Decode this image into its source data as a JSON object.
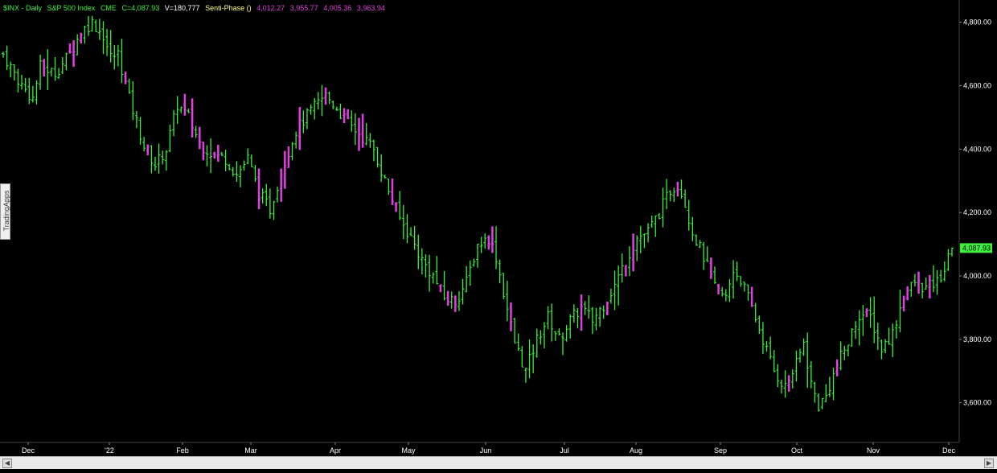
{
  "header": {
    "symbol": "$INX - Daily",
    "name": "S&P 500 Index",
    "exchange": "CME",
    "close": "C=4,087.93",
    "volume": "V=180,777",
    "indicator": "Senti-Phase ()",
    "values": [
      "4,012.27",
      "3,955.77",
      "4,005.36",
      "3,963.94"
    ]
  },
  "watermark": "TradingApps",
  "colors": {
    "background": "#000000",
    "bar_normal": "#3cf03c",
    "bar_phase": "#e040e0",
    "axis_text": "#ffffff",
    "last_price_bg": "#3cf03c"
  },
  "chart_data": {
    "type": "ohlc",
    "title": "$INX - Daily  S&P 500 Index  CME",
    "ylim": [
      3480,
      4850
    ],
    "y_ticks": [
      "4,800.00",
      "4,600.00",
      "4,400.00",
      "4,200.00",
      "4,000.00",
      "3,800.00",
      "3,600.00"
    ],
    "y_tick_values": [
      4800,
      4600,
      4400,
      4200,
      4000,
      3800,
      3600
    ],
    "x_labels": [
      "Dec",
      "'22",
      "Feb",
      "Mar",
      "Apr",
      "May",
      "Jun",
      "Jul",
      "Aug",
      "Sep",
      "Oct",
      "Nov",
      "Dec"
    ],
    "last_price": "4,087.93",
    "last_value": 4087.93,
    "grid": false,
    "series": [
      {
        "anchors": [
          [
            0,
            4700
          ],
          [
            5,
            4600
          ],
          [
            8,
            4560
          ],
          [
            10,
            4660
          ],
          [
            14,
            4640
          ],
          [
            18,
            4700
          ],
          [
            21,
            4770
          ],
          [
            24,
            4800
          ],
          [
            27,
            4760
          ],
          [
            29,
            4690
          ],
          [
            31,
            4700
          ],
          [
            34,
            4560
          ],
          [
            38,
            4410
          ],
          [
            41,
            4350
          ],
          [
            44,
            4400
          ],
          [
            47,
            4540
          ],
          [
            50,
            4500
          ],
          [
            53,
            4420
          ],
          [
            57,
            4380
          ],
          [
            60,
            4370
          ],
          [
            63,
            4320
          ],
          [
            66,
            4370
          ],
          [
            69,
            4260
          ],
          [
            72,
            4210
          ],
          [
            75,
            4330
          ],
          [
            79,
            4460
          ],
          [
            83,
            4520
          ],
          [
            87,
            4570
          ],
          [
            90,
            4530
          ],
          [
            93,
            4480
          ],
          [
            96,
            4450
          ],
          [
            100,
            4400
          ],
          [
            103,
            4300
          ],
          [
            107,
            4180
          ],
          [
            110,
            4120
          ],
          [
            113,
            4050
          ],
          [
            116,
            4000
          ],
          [
            119,
            3930
          ],
          [
            122,
            3920
          ],
          [
            125,
            3980
          ],
          [
            128,
            4100
          ],
          [
            131,
            4120
          ],
          [
            133,
            4060
          ],
          [
            135,
            3950
          ],
          [
            138,
            3790
          ],
          [
            141,
            3700
          ],
          [
            144,
            3800
          ],
          [
            147,
            3870
          ],
          [
            150,
            3800
          ],
          [
            153,
            3860
          ],
          [
            156,
            3900
          ],
          [
            159,
            3860
          ],
          [
            162,
            3910
          ],
          [
            165,
            3970
          ],
          [
            168,
            4050
          ],
          [
            171,
            4120
          ],
          [
            174,
            4140
          ],
          [
            177,
            4200
          ],
          [
            180,
            4270
          ],
          [
            182,
            4290
          ],
          [
            184,
            4230
          ],
          [
            186,
            4140
          ],
          [
            189,
            4060
          ],
          [
            192,
            3960
          ],
          [
            195,
            3930
          ],
          [
            197,
            4020
          ],
          [
            199,
            3990
          ],
          [
            202,
            3900
          ],
          [
            205,
            3800
          ],
          [
            208,
            3700
          ],
          [
            211,
            3650
          ],
          [
            214,
            3720
          ],
          [
            216,
            3790
          ],
          [
            218,
            3660
          ],
          [
            220,
            3590
          ],
          [
            222,
            3620
          ],
          [
            225,
            3720
          ],
          [
            228,
            3790
          ],
          [
            231,
            3880
          ],
          [
            234,
            3870
          ],
          [
            237,
            3770
          ],
          [
            240,
            3820
          ],
          [
            243,
            3940
          ],
          [
            246,
            3980
          ],
          [
            249,
            3960
          ],
          [
            252,
            3980
          ],
          [
            254,
            4020
          ],
          [
            256,
            4085
          ]
        ],
        "n_bars": 257,
        "last_close": 4087.93
      }
    ]
  }
}
